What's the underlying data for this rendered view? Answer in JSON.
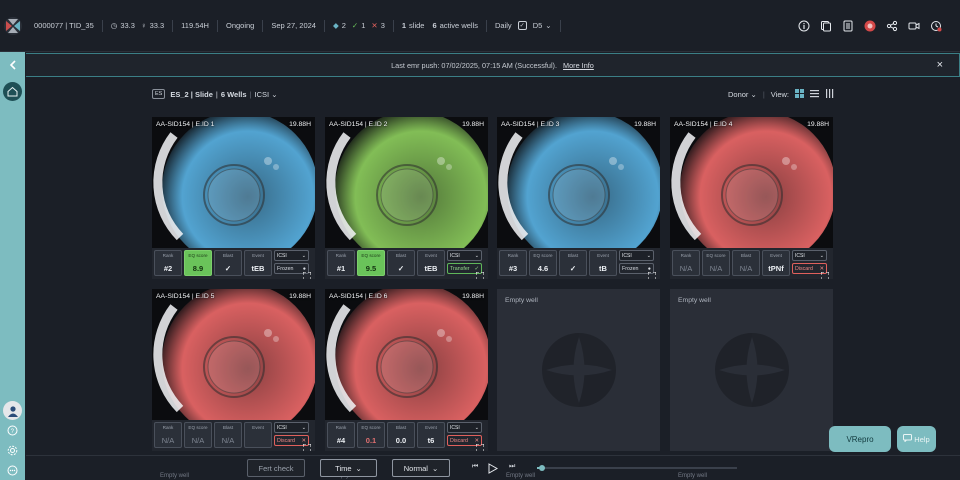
{
  "topbar": {
    "patient_id": "0000077 | TID_35",
    "age_female": "33.3",
    "age_male": "33.3",
    "elapsed": "119.54H",
    "status": "Ongoing",
    "date": "Sep 27, 2024",
    "count_a": "2",
    "count_b": "1",
    "count_c": "3",
    "slide_count": "1",
    "slide_label": "slide",
    "wells_count": "6",
    "wells_label": "active wells",
    "frequency": "Daily",
    "day": "D5",
    "icons": [
      "info-icon",
      "copy-icon",
      "document-icon",
      "notes-icon",
      "share-icon",
      "video-icon",
      "history-icon"
    ]
  },
  "banner": {
    "text": "Last emr push: 07/02/2025, 07:15 AM (Successful).",
    "link": "More Info",
    "close": "×"
  },
  "slide_header": {
    "badge": "ES",
    "title": "ES_2 | Slide",
    "wells": "6 Wells",
    "method": "ICSI",
    "donor": "Donor",
    "view_label": "View:"
  },
  "wells": [
    {
      "name": "AA-SID154 | E.ID 1",
      "time": "19.88H",
      "tint": "#5ab4e6",
      "rank": "#2",
      "eq_score": "8.9",
      "eq_green": true,
      "blast": "✓",
      "event": "tEB",
      "method": "ICSI",
      "status": "Frozen",
      "status_type": "frozen"
    },
    {
      "name": "AA-SID154 | E.ID 2",
      "time": "19.88H",
      "tint": "#8fd15e",
      "rank": "#1",
      "eq_score": "9.5",
      "eq_green": true,
      "blast": "✓",
      "event": "tEB",
      "method": "ICSI",
      "status": "Transfer",
      "status_type": "transfer"
    },
    {
      "name": "AA-SID154 | E.ID 3",
      "time": "19.88H",
      "tint": "#5ab4e6",
      "rank": "#3",
      "eq_score": "4.6",
      "eq_green": false,
      "blast": "✓",
      "event": "tB",
      "method": "ICSI",
      "status": "Frozen",
      "status_type": "frozen"
    },
    {
      "name": "AA-SID154 | E.ID 4",
      "time": "19.88H",
      "tint": "#f06a6a",
      "rank": "N/A",
      "eq_score": "N/A",
      "eq_green": false,
      "blast": "N/A",
      "event": "tPNf",
      "method": "ICSI",
      "status": "Discard",
      "status_type": "discard"
    },
    {
      "name": "AA-SID154 | E.ID 5",
      "time": "19.88H",
      "tint": "#f06a6a",
      "rank": "N/A",
      "eq_score": "N/A",
      "eq_green": false,
      "blast": "N/A",
      "event": "",
      "method": "ICSI",
      "status": "Discard",
      "status_type": "discard"
    },
    {
      "name": "AA-SID154 | E.ID 6",
      "time": "19.88H",
      "tint": "#f06a6a",
      "rank": "#4",
      "eq_score": "0.1",
      "eq_green": false,
      "blast": "0.0",
      "event": "t6",
      "method": "ICSI",
      "status": "Discard",
      "status_type": "discard"
    }
  ],
  "cell_labels": {
    "rank": "Rank",
    "eq": "EQ score",
    "blast": "Blast",
    "event": "Event"
  },
  "empty_well_label": "Empty well",
  "bottombar": {
    "fert_check": "Fert check",
    "time": "Time",
    "normal": "Normal",
    "ghost_label": "Empty well"
  },
  "buttons": {
    "vrepro": "VRepro",
    "help": "Help"
  },
  "colors": {
    "accent": "#7dbcc0",
    "bg": "#1b1f27",
    "green": "#6ac35a",
    "discard": "#e0605c"
  }
}
